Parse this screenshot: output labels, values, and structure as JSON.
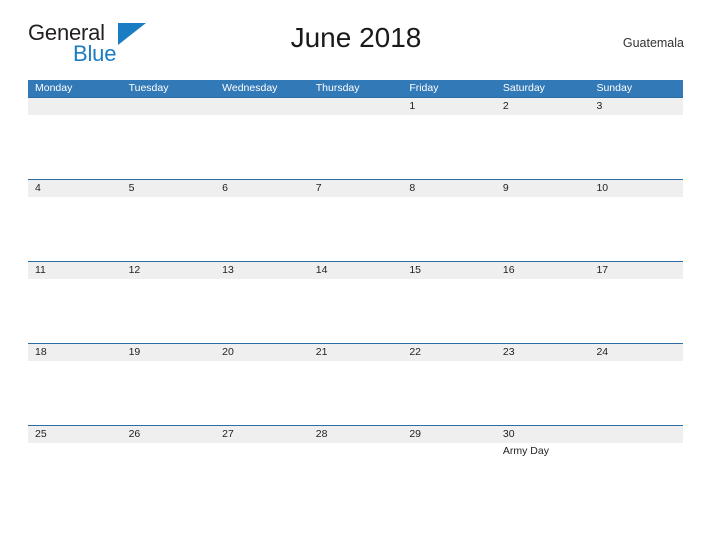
{
  "brand": {
    "word1": "General",
    "word2": "Blue",
    "accent_color": "#1a7dc4"
  },
  "header": {
    "title": "June 2018",
    "locale": "Guatemala"
  },
  "colors": {
    "weekday_header_bg": "#3279b8",
    "date_band_bg": "#efefef",
    "rule": "#2e6da4",
    "page_bg": "#ffffff"
  },
  "calendar": {
    "weekdays": [
      "Monday",
      "Tuesday",
      "Wednesday",
      "Thursday",
      "Friday",
      "Saturday",
      "Sunday"
    ],
    "weeks": [
      {
        "days": [
          {
            "date": "",
            "events": []
          },
          {
            "date": "",
            "events": []
          },
          {
            "date": "",
            "events": []
          },
          {
            "date": "",
            "events": []
          },
          {
            "date": "1",
            "events": []
          },
          {
            "date": "2",
            "events": []
          },
          {
            "date": "3",
            "events": []
          }
        ]
      },
      {
        "days": [
          {
            "date": "4",
            "events": []
          },
          {
            "date": "5",
            "events": []
          },
          {
            "date": "6",
            "events": []
          },
          {
            "date": "7",
            "events": []
          },
          {
            "date": "8",
            "events": []
          },
          {
            "date": "9",
            "events": []
          },
          {
            "date": "10",
            "events": []
          }
        ]
      },
      {
        "days": [
          {
            "date": "11",
            "events": []
          },
          {
            "date": "12",
            "events": []
          },
          {
            "date": "13",
            "events": []
          },
          {
            "date": "14",
            "events": []
          },
          {
            "date": "15",
            "events": []
          },
          {
            "date": "16",
            "events": []
          },
          {
            "date": "17",
            "events": []
          }
        ]
      },
      {
        "days": [
          {
            "date": "18",
            "events": []
          },
          {
            "date": "19",
            "events": []
          },
          {
            "date": "20",
            "events": []
          },
          {
            "date": "21",
            "events": []
          },
          {
            "date": "22",
            "events": []
          },
          {
            "date": "23",
            "events": []
          },
          {
            "date": "24",
            "events": []
          }
        ]
      },
      {
        "days": [
          {
            "date": "25",
            "events": []
          },
          {
            "date": "26",
            "events": []
          },
          {
            "date": "27",
            "events": []
          },
          {
            "date": "28",
            "events": []
          },
          {
            "date": "29",
            "events": []
          },
          {
            "date": "30",
            "events": [
              "Army Day"
            ]
          },
          {
            "date": "",
            "events": []
          }
        ]
      }
    ]
  }
}
